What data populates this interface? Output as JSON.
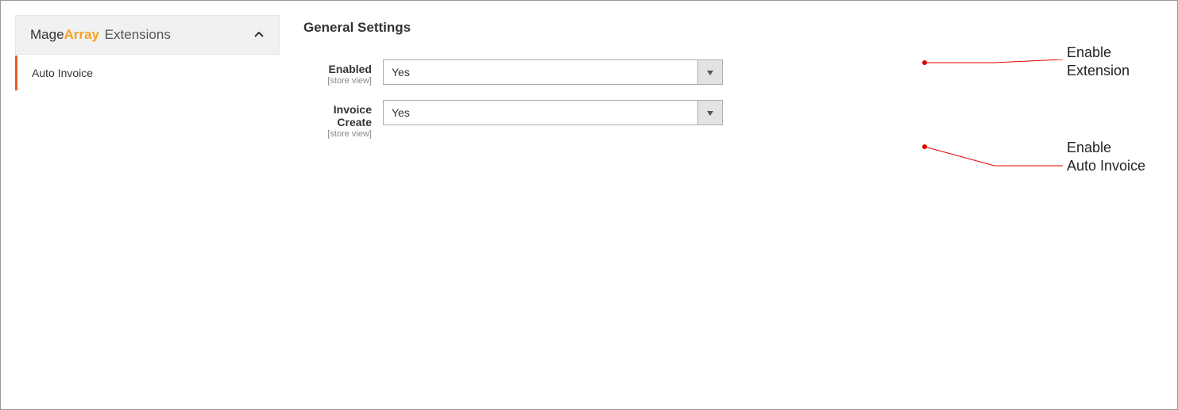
{
  "sidebar": {
    "brand_part1": "Mage",
    "brand_part2": "Array",
    "brand_part3": "Extensions",
    "items": [
      {
        "label": "Auto Invoice"
      }
    ]
  },
  "main": {
    "section_title": "General Settings",
    "fields": [
      {
        "label": "Enabled",
        "scope": "[store view]",
        "value": "Yes"
      },
      {
        "label": "Invoice Create",
        "scope": "[store view]",
        "value": "Yes"
      }
    ]
  },
  "annotations": {
    "anno1": "Enable Extension",
    "anno2_line1": "Enable",
    "anno2_line2": "Auto Invoice"
  }
}
